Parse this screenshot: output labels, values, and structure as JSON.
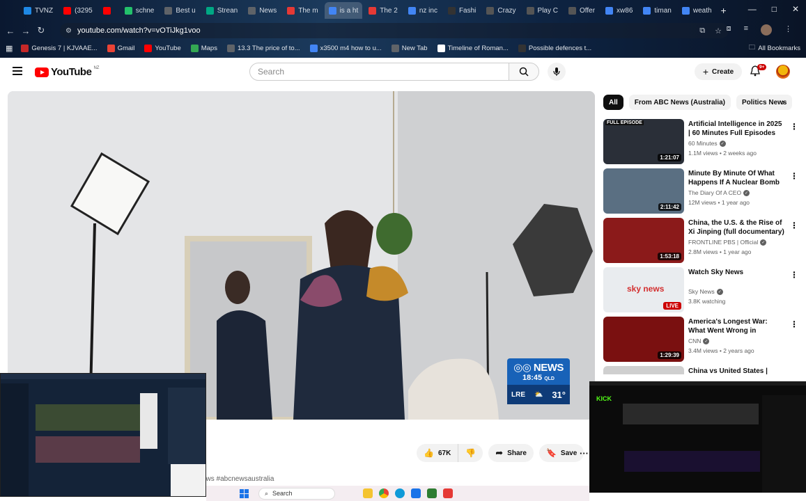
{
  "browser": {
    "tabs": [
      {
        "label": "TVNZ",
        "color": "#1e88e5"
      },
      {
        "label": "(3295",
        "color": "#ff0000"
      },
      {
        "label": "",
        "color": "#ff0000"
      },
      {
        "label": "schne",
        "color": "#23c16b"
      },
      {
        "label": "Best u",
        "color": "#5f6368"
      },
      {
        "label": "Strean",
        "color": "#00a884"
      },
      {
        "label": "News",
        "color": "#5f6368"
      },
      {
        "label": "The m",
        "color": "#e53935"
      },
      {
        "label": "is a ht",
        "color": "#4285f4"
      },
      {
        "label": "The 2",
        "color": "#e53935"
      },
      {
        "label": "nz inc",
        "color": "#4285f4"
      },
      {
        "label": "Fashi",
        "color": "#333333"
      },
      {
        "label": "Crazy",
        "color": "#555555"
      },
      {
        "label": "Play C",
        "color": "#555555"
      },
      {
        "label": "Offer",
        "color": "#555555"
      },
      {
        "label": "xw86",
        "color": "#4285f4"
      },
      {
        "label": "timan",
        "color": "#4285f4"
      },
      {
        "label": "weath",
        "color": "#4285f4"
      }
    ],
    "new_tab_glyph": "+",
    "window_controls": {
      "minimize": "—",
      "maximize": "□",
      "close": "✕"
    },
    "url": "youtube.com/watch?v=vOTiJkg1voo",
    "bookmarks": [
      {
        "label": "Genesis 7 | KJVAAE...",
        "color": "#c62828"
      },
      {
        "label": "Gmail",
        "color": "#ea4335"
      },
      {
        "label": "YouTube",
        "color": "#ff0000"
      },
      {
        "label": "Maps",
        "color": "#34a853"
      },
      {
        "label": "13.3 The price of to...",
        "color": "#5f6368"
      },
      {
        "label": "x3500 m4 how to u...",
        "color": "#4285f4"
      },
      {
        "label": "New Tab",
        "color": "#5f6368"
      },
      {
        "label": "Timeline of Roman...",
        "color": "#ffffff"
      },
      {
        "label": "Possible defences t...",
        "color": "#333333"
      }
    ],
    "all_bookmarks": "All Bookmarks"
  },
  "youtube": {
    "logo_text": "YouTube",
    "country_code": "NZ",
    "search_placeholder": "Search",
    "create_label": "Create",
    "notification_count": "9+",
    "chips": [
      "All",
      "From ABC News (Australia)",
      "Politics News"
    ],
    "video_overlay": {
      "brand": "NEWS",
      "time": "18:45",
      "tz": "QLD",
      "location": "LRE",
      "temperature": "31°"
    },
    "actions": {
      "likes": "67K",
      "share": "Share",
      "save": "Save",
      "more": "···"
    },
    "hashtag_text": "ews #abcnewsaustralia",
    "recommendations": [
      {
        "title": "Artificial Intelligence in 2025 | 60 Minutes Full Episodes",
        "channel": "60 Minutes",
        "meta": "1.1M views • 2 weeks ago",
        "duration": "1:21:07",
        "thumb_color": "#2a2f38",
        "badge": "FULL EPISODE"
      },
      {
        "title": "Minute By Minute Of What Happens If A Nuclear Bomb ...",
        "channel": "The Diary Of A CEO",
        "meta": "12M views • 1 year ago",
        "duration": "2:11:42",
        "thumb_color": "#5a6f82",
        "badge": ""
      },
      {
        "title": "China, the U.S. & the Rise of Xi Jinping (full documentary) | ...",
        "channel": "FRONTLINE PBS | Official",
        "meta": "2.8M views • 1 year ago",
        "duration": "1:53:18",
        "thumb_color": "#8b1a1a",
        "badge": ""
      },
      {
        "title": "Watch Sky News",
        "channel": "Sky News",
        "meta": "3.8K watching",
        "duration": "LIVE",
        "thumb_color": "#e9ecef",
        "badge": ""
      },
      {
        "title": "America's Longest War: What Went Wrong in Afghanistan ...",
        "channel": "CNN",
        "meta": "3.4M views • 2 years ago",
        "duration": "1:29:39",
        "thumb_color": "#7a1010",
        "badge": ""
      },
      {
        "title": "China vs United States | Behind",
        "channel": "",
        "meta": "",
        "duration": "",
        "thumb_color": "#cfcfcf",
        "badge": ""
      }
    ]
  },
  "taskbar": {
    "search_label": "Search"
  }
}
